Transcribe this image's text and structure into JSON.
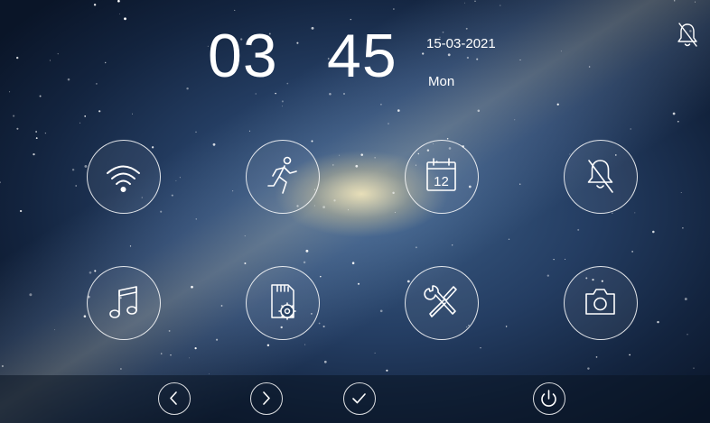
{
  "clock": {
    "hours": "03",
    "minutes": "45",
    "date": "15-03-2021",
    "weekday": "Mon"
  },
  "status": {
    "icon": "bell-muted-icon"
  },
  "calendar_tile_day": "12",
  "tiles": [
    {
      "name": "wifi-button",
      "icon": "wifi-icon"
    },
    {
      "name": "motion-button",
      "icon": "running-person-icon"
    },
    {
      "name": "calendar-button",
      "icon": "calendar-icon"
    },
    {
      "name": "mute-button",
      "icon": "bell-muted-icon"
    },
    {
      "name": "music-button",
      "icon": "music-note-icon"
    },
    {
      "name": "sd-card-settings-button",
      "icon": "sd-card-gear-icon"
    },
    {
      "name": "tools-button",
      "icon": "wrench-screwdriver-icon"
    },
    {
      "name": "camera-button",
      "icon": "camera-icon"
    }
  ],
  "bottom_bar": [
    {
      "name": "previous-button",
      "icon": "chevron-left-icon"
    },
    {
      "name": "next-button",
      "icon": "chevron-right-icon"
    },
    {
      "name": "confirm-button",
      "icon": "checkmark-icon"
    },
    {
      "name": "power-button",
      "icon": "power-icon"
    }
  ],
  "colors": {
    "icon_stroke": "#ffffff",
    "background_deep": "#0b1830",
    "galaxy_core": "#fff0be"
  }
}
